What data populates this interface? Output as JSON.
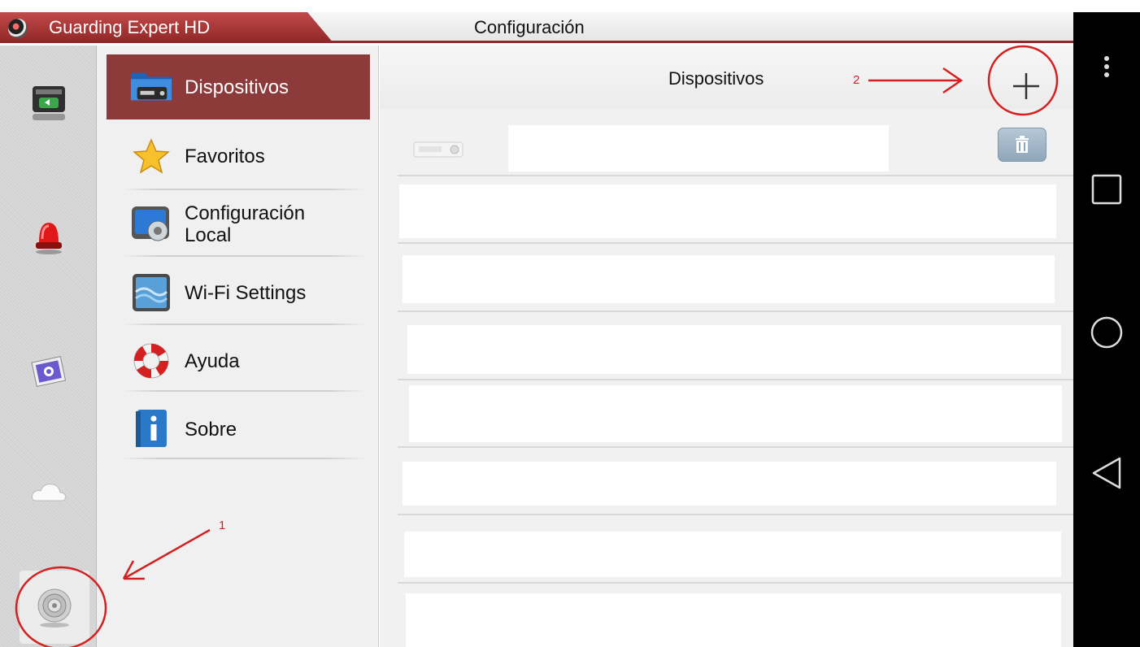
{
  "app": {
    "name": "Guarding Expert HD",
    "page_title": "Configuración"
  },
  "rail": {
    "items": [
      {
        "icon": "playback-icon"
      },
      {
        "icon": "alarm-icon"
      },
      {
        "icon": "picture-icon"
      },
      {
        "icon": "cloud-icon"
      },
      {
        "icon": "settings-icon"
      }
    ]
  },
  "menu": {
    "items": [
      {
        "label": "Dispositivos",
        "icon": "device-icon",
        "active": true
      },
      {
        "label": "Favoritos",
        "icon": "star-icon"
      },
      {
        "label": "Configuración\nLocal",
        "icon": "local-config-icon"
      },
      {
        "label": "Wi-Fi Settings",
        "icon": "wifi-settings-icon"
      },
      {
        "label": "Ayuda",
        "icon": "lifebuoy-icon"
      },
      {
        "label": "Sobre",
        "icon": "info-icon"
      }
    ]
  },
  "content": {
    "header_title": "Dispositivos",
    "rows": 8
  },
  "annotations": {
    "one": "1",
    "two": "2"
  },
  "colors": {
    "accent": "#8c3a3a",
    "annotation": "#d32020"
  }
}
